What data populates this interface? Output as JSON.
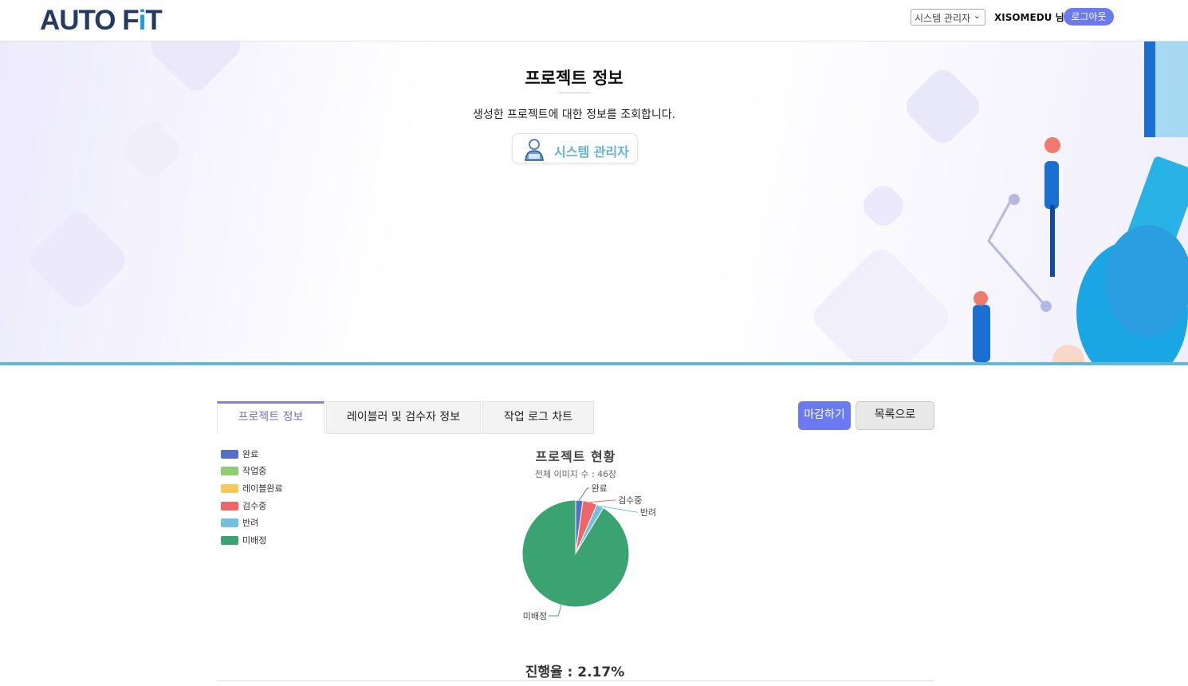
{
  "header": {
    "logo": "AUTO FIT",
    "role_select": "시스템 관리자",
    "user_name": "XISOMEDU 님",
    "logout": "로그아웃"
  },
  "hero": {
    "title": "프로젝트 정보",
    "description": "생성한 프로젝트에 대한 정보를 조회합니다.",
    "role_badge": "시스템 관리자"
  },
  "tabs": [
    {
      "label": "프로젝트 정보",
      "active": true
    },
    {
      "label": "레이블러 및 검수자 정보",
      "active": false
    },
    {
      "label": "작업 로그 차트",
      "active": false
    }
  ],
  "actions": {
    "close": "마감하기",
    "list": "목록으로"
  },
  "colors": {
    "accent": "#6b7af0",
    "hero_bottom": "#64b8d0",
    "tab_active": "#7b6fb6"
  },
  "chart_data": {
    "type": "pie",
    "title": "프로젝트 현황",
    "subtitle": "전체 이미지 수 : 46장",
    "legend_position": "top-left",
    "categories": [
      "완료",
      "작업중",
      "레이블완료",
      "검수중",
      "반려",
      "미배정"
    ],
    "values": [
      1,
      0,
      0,
      2,
      1,
      42
    ],
    "colors": [
      "#5470c6",
      "#91cc75",
      "#fac858",
      "#ee6666",
      "#73c0de",
      "#3ba272"
    ]
  },
  "progress": "진행율 : 2.17%"
}
